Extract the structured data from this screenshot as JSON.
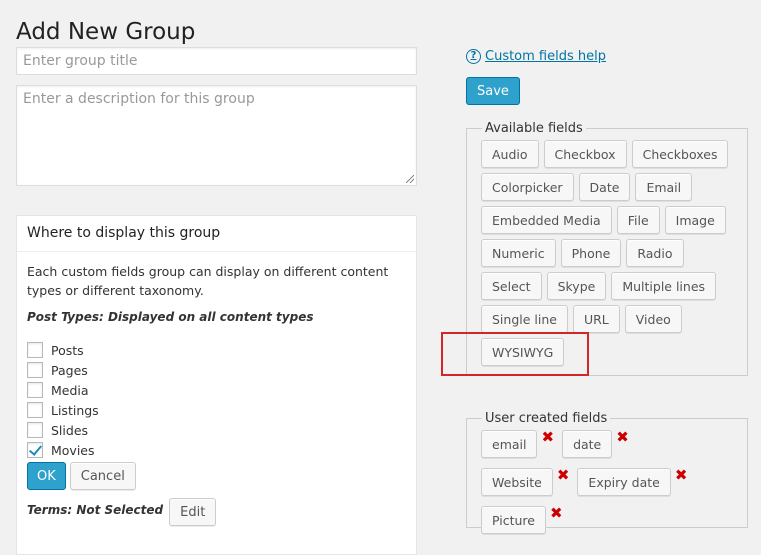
{
  "page": {
    "title": "Add New Group"
  },
  "group_form": {
    "title_placeholder": "Enter group title",
    "description_placeholder": "Enter a description for this group"
  },
  "where_panel": {
    "heading": "Where to display this group",
    "description": "Each custom fields group can display on different content types or different taxonomy.",
    "post_types_label": "Post Types: Displayed on all content types",
    "post_types": [
      {
        "label": "Posts",
        "checked": false
      },
      {
        "label": "Pages",
        "checked": false
      },
      {
        "label": "Media",
        "checked": false
      },
      {
        "label": "Listings",
        "checked": false
      },
      {
        "label": "Slides",
        "checked": false
      },
      {
        "label": "Movies",
        "checked": true
      }
    ],
    "ok_label": "OK",
    "cancel_label": "Cancel",
    "terms_label": "Terms: Not Selected",
    "edit_label": "Edit"
  },
  "sidebar": {
    "help_link": "Custom fields help",
    "help_icon": "question-circle-icon",
    "save_label": "Save",
    "available_legend": "Available fields",
    "available_fields": [
      "Audio",
      "Checkbox",
      "Checkboxes",
      "Colorpicker",
      "Date",
      "Email",
      "Embedded Media",
      "File",
      "Image",
      "Numeric",
      "Phone",
      "Radio",
      "Select",
      "Skype",
      "Multiple lines",
      "Single line",
      "URL",
      "Video",
      "WYSIWYG"
    ],
    "user_legend": "User created fields",
    "user_fields": [
      "email",
      "date",
      "Website",
      "Expiry date",
      "Picture"
    ],
    "remove_icon": "remove-x-icon"
  },
  "colors": {
    "primary": "#2ea2cc",
    "link": "#0074a2",
    "remove": "#cc0000",
    "highlight": "#d02828"
  }
}
